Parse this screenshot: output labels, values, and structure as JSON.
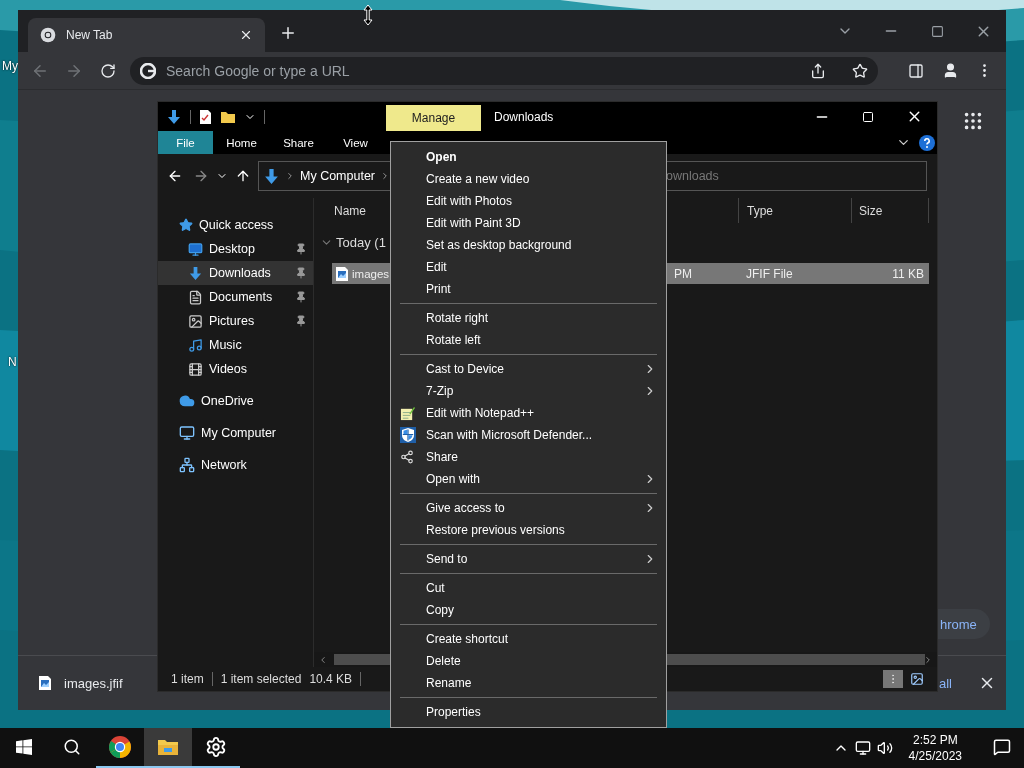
{
  "desktop": {
    "icon_labels": [
      "My",
      "N"
    ]
  },
  "browser": {
    "tabs": [
      {
        "label": "New Tab",
        "selected": true
      }
    ],
    "address": {
      "placeholder": "Search Google or type a URL"
    },
    "customize_button": "hrome",
    "download_bar": {
      "file": "images.jfif",
      "show_all": "all"
    }
  },
  "explorer": {
    "title": "Downloads",
    "contextual_tab": "Manage",
    "ribbon_tabs": [
      {
        "label": "File",
        "selected": true
      },
      {
        "label": "Home",
        "selected": false
      },
      {
        "label": "Share",
        "selected": false
      },
      {
        "label": "View",
        "selected": false
      }
    ],
    "breadcrumb": [
      "My Computer"
    ],
    "search": {
      "placeholder": "ownloads"
    },
    "nav": [
      {
        "label": "Quick access",
        "selected": false,
        "children": [
          {
            "label": "Desktop",
            "pinned": true,
            "selected": false
          },
          {
            "label": "Downloads",
            "pinned": true,
            "selected": true
          },
          {
            "label": "Documents",
            "pinned": true,
            "selected": false
          },
          {
            "label": "Pictures",
            "pinned": true,
            "selected": false
          },
          {
            "label": "Music",
            "pinned": false,
            "selected": false
          },
          {
            "label": "Videos",
            "pinned": false,
            "selected": false
          }
        ]
      },
      {
        "label": "OneDrive",
        "selected": false
      },
      {
        "label": "My Computer",
        "selected": false
      },
      {
        "label": "Network",
        "selected": false
      }
    ],
    "columns": [
      "Name",
      "Type",
      "Size"
    ],
    "group": "Today (1",
    "files": [
      {
        "name": "images",
        "date": "PM",
        "type": "JFIF File",
        "size": "11 KB",
        "selected": true
      }
    ],
    "status": [
      "1 item",
      "1 item selected",
      "10.4 KB"
    ]
  },
  "context_menu": {
    "groups": [
      [
        {
          "label": "Open",
          "bold": true
        },
        {
          "label": "Create a new video"
        },
        {
          "label": "Edit with Photos"
        },
        {
          "label": "Edit with Paint 3D"
        },
        {
          "label": "Set as desktop background"
        },
        {
          "label": "Edit"
        },
        {
          "label": "Print"
        }
      ],
      [
        {
          "label": "Rotate right"
        },
        {
          "label": "Rotate left"
        }
      ],
      [
        {
          "label": "Cast to Device",
          "submenu": true
        },
        {
          "label": "7-Zip",
          "submenu": true
        },
        {
          "label": "Edit with Notepad++",
          "icon": true
        },
        {
          "label": "Scan with Microsoft Defender...",
          "icon": true
        },
        {
          "label": "Share",
          "icon": true
        },
        {
          "label": "Open with",
          "submenu": true
        }
      ],
      [
        {
          "label": "Give access to",
          "submenu": true
        },
        {
          "label": "Restore previous versions"
        }
      ],
      [
        {
          "label": "Send to",
          "submenu": true
        }
      ],
      [
        {
          "label": "Cut"
        },
        {
          "label": "Copy"
        }
      ],
      [
        {
          "label": "Create shortcut"
        },
        {
          "label": "Delete"
        },
        {
          "label": "Rename"
        }
      ],
      [
        {
          "label": "Properties"
        }
      ]
    ]
  },
  "taskbar": {
    "apps": [
      {
        "selected": false,
        "running": true
      },
      {
        "selected": true,
        "running": true
      },
      {
        "selected": false,
        "running": true
      }
    ],
    "time": "2:52 PM",
    "date": "4/25/2023"
  }
}
